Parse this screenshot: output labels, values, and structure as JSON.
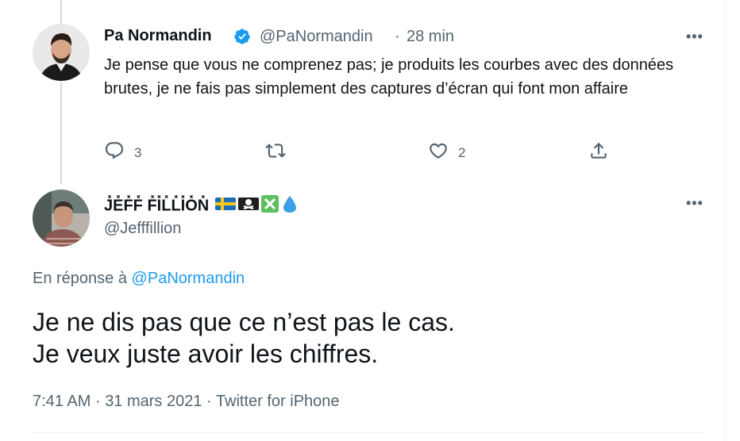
{
  "tweet1": {
    "display_name": "Pa Normandin",
    "handle": "@PaNormandin",
    "separator": "·",
    "time": "28 min",
    "text": "Je pense que vous ne comprenez pas; je produits les courbes avec des données brutes, je ne fais pas simplement des captures d’écran qui font mon affaire",
    "more_label": "•••",
    "actions": {
      "reply_count": "3",
      "like_count": "2"
    }
  },
  "tweet2": {
    "display_name": "J̽E̽F̽F̽ F̽I̽L̽L̽I̽O̽N̽",
    "flag_emojis": "🇸🇪🏴‍☠️❎💧",
    "handle": "@Jefffillion",
    "more_label": "•••",
    "reply_prefix": "En réponse à",
    "reply_to": "@PaNormandin",
    "text_line1": "Je ne dis pas que ce n’est pas le cas.",
    "text_line2": "Je veux juste avoir les chiffres.",
    "time": "7:41 AM",
    "date": "31 mars 2021",
    "source": "Twitter for iPhone",
    "dot": "·"
  },
  "colors": {
    "text": "#0f1419",
    "muted": "#536471",
    "link": "#1d9bf0",
    "verified": "#1d9bf0",
    "thread_line": "#cfd9de"
  }
}
